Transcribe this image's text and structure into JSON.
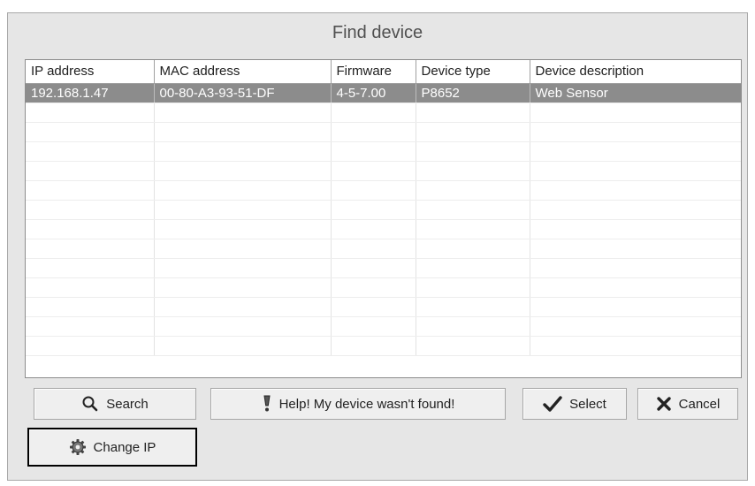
{
  "window": {
    "title": "Find device"
  },
  "table": {
    "columns": [
      "IP address",
      "MAC address",
      "Firmware",
      "Device type",
      "Device description"
    ],
    "rows": [
      {
        "ip": "192.168.1.47",
        "mac": "00-80-A3-93-51-DF",
        "firmware": "4-5-7.00",
        "type": "P8652",
        "description": "Web Sensor",
        "selected": true
      }
    ],
    "empty_rows": 13
  },
  "buttons": {
    "search": {
      "label": "Search",
      "icon": "search-icon"
    },
    "help": {
      "label": "Help! My device wasn't found!",
      "icon": "exclamation-icon"
    },
    "select": {
      "label": "Select",
      "icon": "checkmark-icon"
    },
    "cancel": {
      "label": "Cancel",
      "icon": "x-icon"
    },
    "change_ip": {
      "label": "Change IP",
      "icon": "gear-icon"
    }
  },
  "colors": {
    "selected_row": "#8c8c8c",
    "window_bg": "#e6e6e6",
    "highlight_border": "#000000"
  }
}
